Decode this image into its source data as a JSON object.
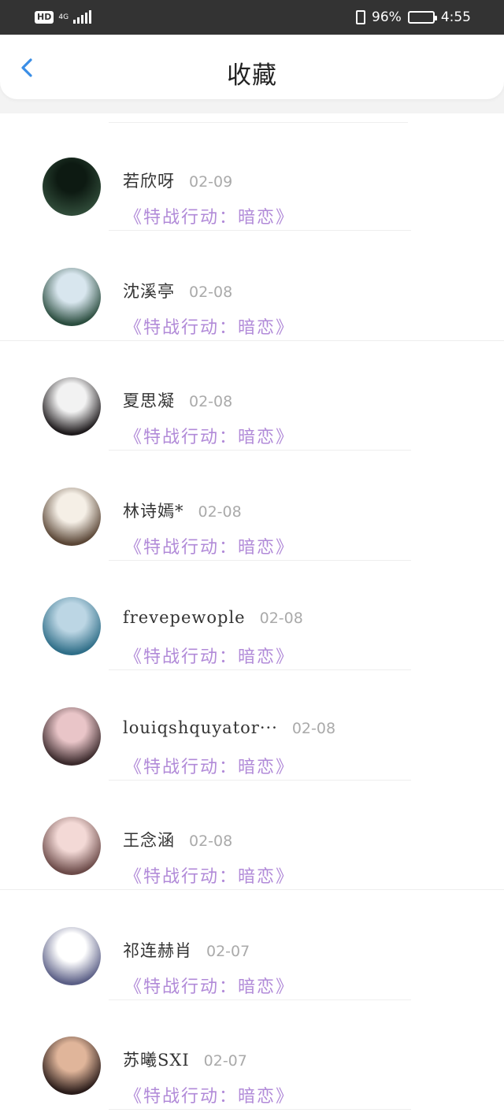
{
  "status_bar": {
    "hd": "HD",
    "network": "4G",
    "battery_percent": "96%",
    "battery_level": 0.96,
    "time": "4:55"
  },
  "header": {
    "title": "收藏",
    "back_icon": "chevron-left-icon",
    "accent_color": "#3a8ee6"
  },
  "favorites": [
    {
      "name": "若欣呀",
      "date": "02-09",
      "work": "《特战行动：暗恋》",
      "avatar_colors": [
        "#0d1a12",
        "#2f4a38"
      ]
    },
    {
      "name": "沈溪亭",
      "date": "02-08",
      "work": "《特战行动：暗恋》",
      "avatar_colors": [
        "#d8e6ee",
        "#2b4d3f"
      ]
    },
    {
      "name": "夏思凝",
      "date": "02-08",
      "work": "《特战行动：暗恋》",
      "avatar_colors": [
        "#f2f2f2",
        "#1e1a1c"
      ]
    },
    {
      "name": "林诗嫣*",
      "date": "02-08",
      "work": "《特战行动：暗恋》",
      "avatar_colors": [
        "#f5efe6",
        "#5a4636"
      ]
    },
    {
      "name": "frevepewople",
      "date": "02-08",
      "work": "《特战行动：暗恋》",
      "avatar_colors": [
        "#bcd6e4",
        "#2f6e88"
      ]
    },
    {
      "name": "louiqshquyator···",
      "date": "02-08",
      "work": "《特战行动：暗恋》",
      "avatar_colors": [
        "#e9c5c8",
        "#3b2a2c"
      ]
    },
    {
      "name": "王念涵",
      "date": "02-08",
      "work": "《特战行动：暗恋》",
      "avatar_colors": [
        "#f3d9d6",
        "#6b4a48"
      ]
    },
    {
      "name": "祁连赫肖",
      "date": "02-07",
      "work": "《特战行动：暗恋》",
      "avatar_colors": [
        "#ffffff",
        "#5b5f86"
      ]
    },
    {
      "name": "苏曦SXI",
      "date": "02-07",
      "work": "《特战行动：暗恋》",
      "avatar_colors": [
        "#e0b59a",
        "#2a1c1a"
      ]
    }
  ],
  "colors": {
    "work_title": "#b18ad8",
    "date": "#aaaaaa",
    "status_bar_bg": "#333333"
  }
}
